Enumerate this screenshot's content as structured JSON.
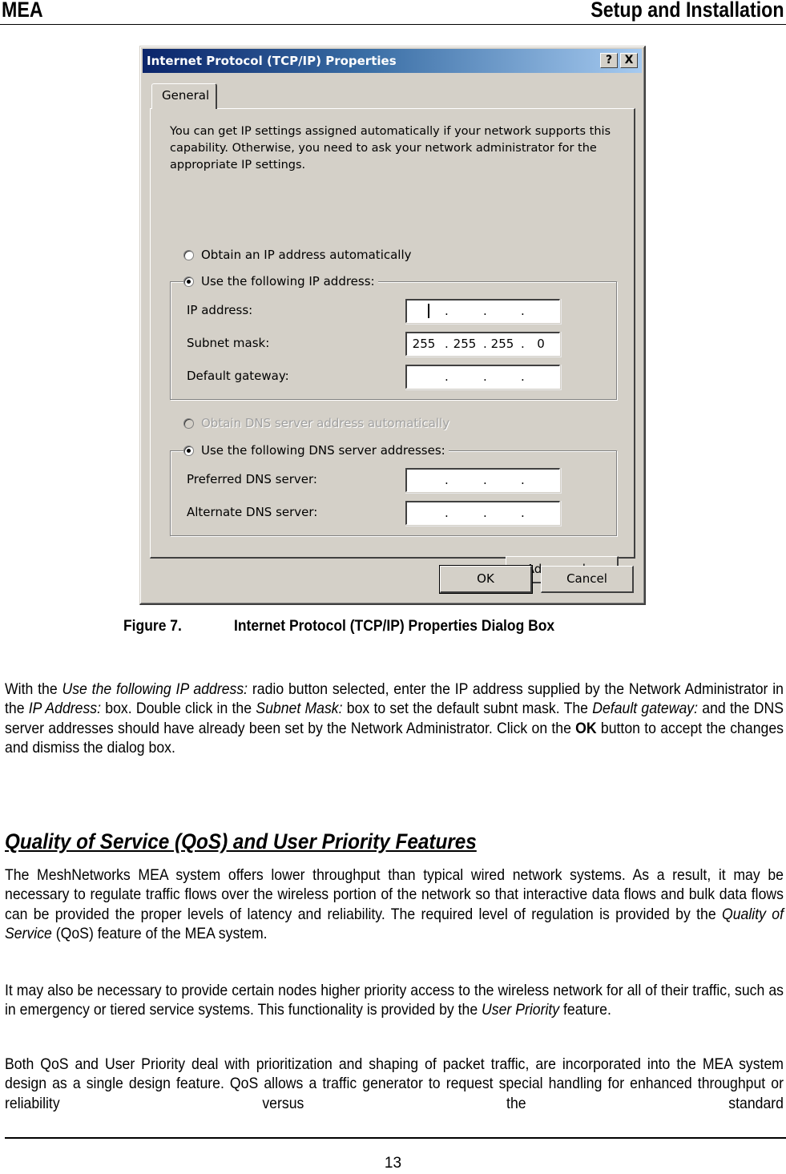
{
  "page_header": {
    "left": "MEA",
    "right": "Setup and Installation"
  },
  "dialog": {
    "title": "Internet Protocol (TCP/IP) Properties",
    "help_button": "?",
    "close_button": "X",
    "tabs": [
      {
        "label": "General",
        "active": true
      }
    ],
    "intro_text": "You can get IP settings assigned automatically if your network supports this capability. Otherwise, you need to ask your network administrator for the appropriate IP settings.",
    "ip_options": {
      "auto": {
        "label": "Obtain an IP address automatically",
        "checked": false
      },
      "manual": {
        "label": "Use the following IP address:",
        "checked": true
      }
    },
    "ip_fields": [
      {
        "label": "IP address:",
        "octets": [
          "",
          "",
          "",
          ""
        ],
        "focused": true
      },
      {
        "label": "Subnet mask:",
        "octets": [
          "255",
          "255",
          "255",
          "0"
        ]
      },
      {
        "label": "Default gateway:",
        "octets": [
          "",
          "",
          "",
          ""
        ]
      }
    ],
    "dns_options": {
      "auto": {
        "label": "Obtain DNS server address automatically",
        "checked": false,
        "disabled": true
      },
      "manual": {
        "label": "Use the following DNS server addresses:",
        "checked": true
      }
    },
    "dns_fields": [
      {
        "label": "Preferred DNS server:",
        "octets": [
          "",
          "",
          "",
          ""
        ]
      },
      {
        "label": "Alternate DNS server:",
        "octets": [
          "",
          "",
          "",
          ""
        ]
      }
    ],
    "buttons": {
      "advanced": "Advanced...",
      "ok": "OK",
      "cancel": "Cancel"
    }
  },
  "caption": {
    "number": "Figure 7.",
    "text": "Internet Protocol (TCP/IP) Properties Dialog Box"
  },
  "paragraph1": {
    "t1": "With the ",
    "i1": "Use the following IP address:",
    "t2": " radio button selected, enter the IP address supplied by the Network Administrator in the ",
    "i2": "IP Address:",
    "t3": " box.  Double click in the ",
    "i3": "Subnet Mask:",
    "t4": " box to set the default subnt mask.  The ",
    "i4": "Default gateway:",
    "t5": " and the DNS server addresses should have already been set by the Network Administrator.   Click on the ",
    "b1": "OK",
    "t6": " button to accept the changes and dismiss the dialog box."
  },
  "section_title": "Quality of Service (QoS) and User Priority Features",
  "paragraph2": {
    "t1": "The MeshNetworks MEA system offers lower throughput than typical wired network systems. As a result, it may be necessary to regulate traffic flows over the wireless portion of the network so that interactive data flows and bulk data flows can be provided the proper levels of latency and reliability.  The required level of regulation is provided by the ",
    "i1": "Quality of Service",
    "t2": " (QoS) feature of the MEA system."
  },
  "paragraph3": {
    "t1": "It may also be necessary to provide certain nodes higher priority access to the wireless network for all of their traffic, such as in emergency or tiered service systems.  This functionality is provided by the ",
    "i1": "User Priority",
    "t2": " feature."
  },
  "paragraph4": {
    "t1": "Both QoS and User Priority deal with prioritization and shaping of packet traffic, are incorporated into the MEA system design as a single design feature.  QoS allows a traffic generator to request special handling for enhanced throughput or reliability versus the standard"
  },
  "page_number": "13"
}
